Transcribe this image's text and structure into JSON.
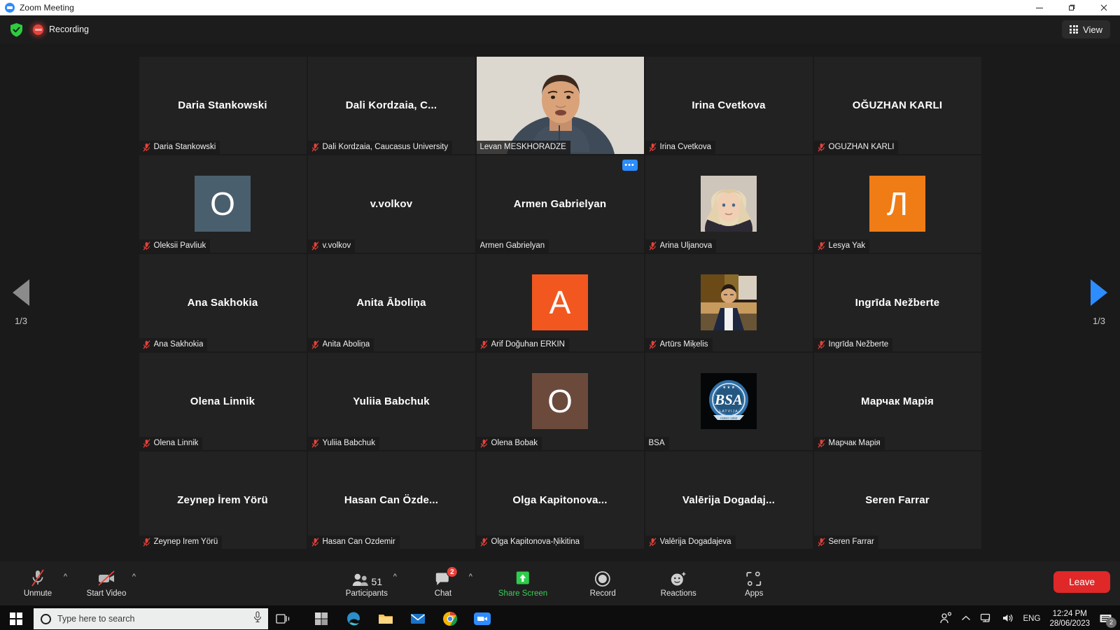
{
  "window": {
    "title": "Zoom Meeting",
    "app_icon": "zoom-logo-icon",
    "minimize": "minimize-icon",
    "maximize": "restore-icon",
    "close": "close-icon"
  },
  "topbar": {
    "shield_icon": "shield-check-icon",
    "recording_label": "Recording",
    "recording_icon": "recording-dot-icon",
    "view_label": "View",
    "view_icon": "grid-view-icon"
  },
  "navigation": {
    "prev_icon": "left-triangle-icon",
    "next_icon": "right-triangle-icon",
    "prev_page": "1/3",
    "next_page": "1/3"
  },
  "participants": [
    {
      "display": "Daria Stankowski",
      "label": "Daria Stankowski",
      "muted": true,
      "kind": "name"
    },
    {
      "display": "Dali Kordzaia, C...",
      "label": "Dali Kordzaia, Caucasus University",
      "muted": true,
      "kind": "name"
    },
    {
      "display": "Levan MESKHORADZE",
      "label": "Levan MESKHORADZE",
      "muted": false,
      "kind": "video",
      "active": true
    },
    {
      "display": "Irina Cvetkova",
      "label": "Irina Cvetkova",
      "muted": true,
      "kind": "name"
    },
    {
      "display": "OĞUZHAN KARLI",
      "label": "OĞUZHAN KARLI",
      "muted": true,
      "kind": "name"
    },
    {
      "display": "O",
      "label": "Oleksii Pavliuk",
      "muted": true,
      "kind": "initial",
      "color": "#4a5f6e"
    },
    {
      "display": "v.volkov",
      "label": "v.volkov",
      "muted": true,
      "kind": "name"
    },
    {
      "display": "Armen Gabrielyan",
      "label": "Armen Gabrielyan",
      "muted": false,
      "kind": "name",
      "more": "•••"
    },
    {
      "display": "",
      "label": "Arina Uljanova",
      "muted": true,
      "kind": "photo",
      "photo": "portrait-blonde-woman"
    },
    {
      "display": "Л",
      "label": "Lesya Yak",
      "muted": true,
      "kind": "initial",
      "color": "#f07c16"
    },
    {
      "display": "Ana Sakhokia",
      "label": "Ana Sakhokia",
      "muted": true,
      "kind": "name"
    },
    {
      "display": "Anita Āboliņa",
      "label": "Anita Āboliņa",
      "muted": true,
      "kind": "name"
    },
    {
      "display": "A",
      "label": "Arif Doğuhan ERKİN",
      "muted": true,
      "kind": "initial",
      "color": "#f2571f"
    },
    {
      "display": "",
      "label": "Artūrs Miķelis",
      "muted": true,
      "kind": "photo",
      "photo": "portrait-man-suit"
    },
    {
      "display": "Ingrīda Nežberte",
      "label": "Ingrīda Nežberte",
      "muted": true,
      "kind": "name"
    },
    {
      "display": "Olena Linnik",
      "label": "Olena Linnik",
      "muted": true,
      "kind": "name"
    },
    {
      "display": "Yuliia Babchuk",
      "label": "Yuliia Babchuk",
      "muted": true,
      "kind": "name"
    },
    {
      "display": "O",
      "label": "Olena Bobak",
      "muted": true,
      "kind": "initial",
      "color": "#6b4a3c"
    },
    {
      "display": "",
      "label": "BSA",
      "muted": false,
      "kind": "logo",
      "logo": "bsa-latvija-seal"
    },
    {
      "display": "Марчак Марія",
      "label": "Марчак Марія",
      "muted": true,
      "kind": "name"
    },
    {
      "display": "Zeynep İrem Yörü",
      "label": "Zeynep İrem Yörü",
      "muted": true,
      "kind": "name"
    },
    {
      "display": "Hasan Can Özde...",
      "label": "Hasan Can Özdemir",
      "muted": true,
      "kind": "name"
    },
    {
      "display": "Olga  Kapitonova...",
      "label": "Olga Kapitonova-Ņikitina",
      "muted": true,
      "kind": "name"
    },
    {
      "display": "Valērija  Dogadaj...",
      "label": "Valērija Dogadajeva",
      "muted": true,
      "kind": "name"
    },
    {
      "display": "Seren Farrar",
      "label": "Seren Farrar",
      "muted": true,
      "kind": "name"
    }
  ],
  "toolbar": {
    "unmute_label": "Unmute",
    "unmute_icon": "mic-muted-icon",
    "start_video_label": "Start Video",
    "start_video_icon": "camera-off-icon",
    "participants_label": "Participants",
    "participants_icon": "people-icon",
    "participants_count": "51",
    "chat_label": "Chat",
    "chat_icon": "chat-bubble-icon",
    "chat_badge": "2",
    "share_screen_label": "Share Screen",
    "share_screen_icon": "share-arrow-up-icon",
    "record_label": "Record",
    "record_icon": "record-circle-icon",
    "reactions_label": "Reactions",
    "reactions_icon": "smiley-plus-icon",
    "apps_label": "Apps",
    "apps_icon": "apps-bracket-icon",
    "leave_label": "Leave",
    "caret_icon": "chevron-up-icon",
    "accent_green": "#3ccc5a",
    "leave_red": "#e02828"
  },
  "taskbar": {
    "start_icon": "windows-start-icon",
    "search_placeholder": "Type here to search",
    "search_icon": "search-circle-icon",
    "mic_icon": "microphone-icon",
    "task_view_icon": "task-view-icon",
    "apps": [
      {
        "name": "microsoft-store-icon"
      },
      {
        "name": "edge-browser-icon"
      },
      {
        "name": "file-explorer-icon"
      },
      {
        "name": "mail-icon"
      },
      {
        "name": "chrome-browser-icon"
      },
      {
        "name": "zoom-app-icon"
      }
    ],
    "tray": {
      "people_icon": "people-share-icon",
      "overflow_icon": "chevron-up-icon",
      "network_icon": "network-icon",
      "volume_icon": "volume-icon",
      "language": "ENG",
      "time": "12:24 PM",
      "date": "28/06/2023",
      "notification_icon": "notification-icon",
      "notification_count": "2"
    }
  }
}
